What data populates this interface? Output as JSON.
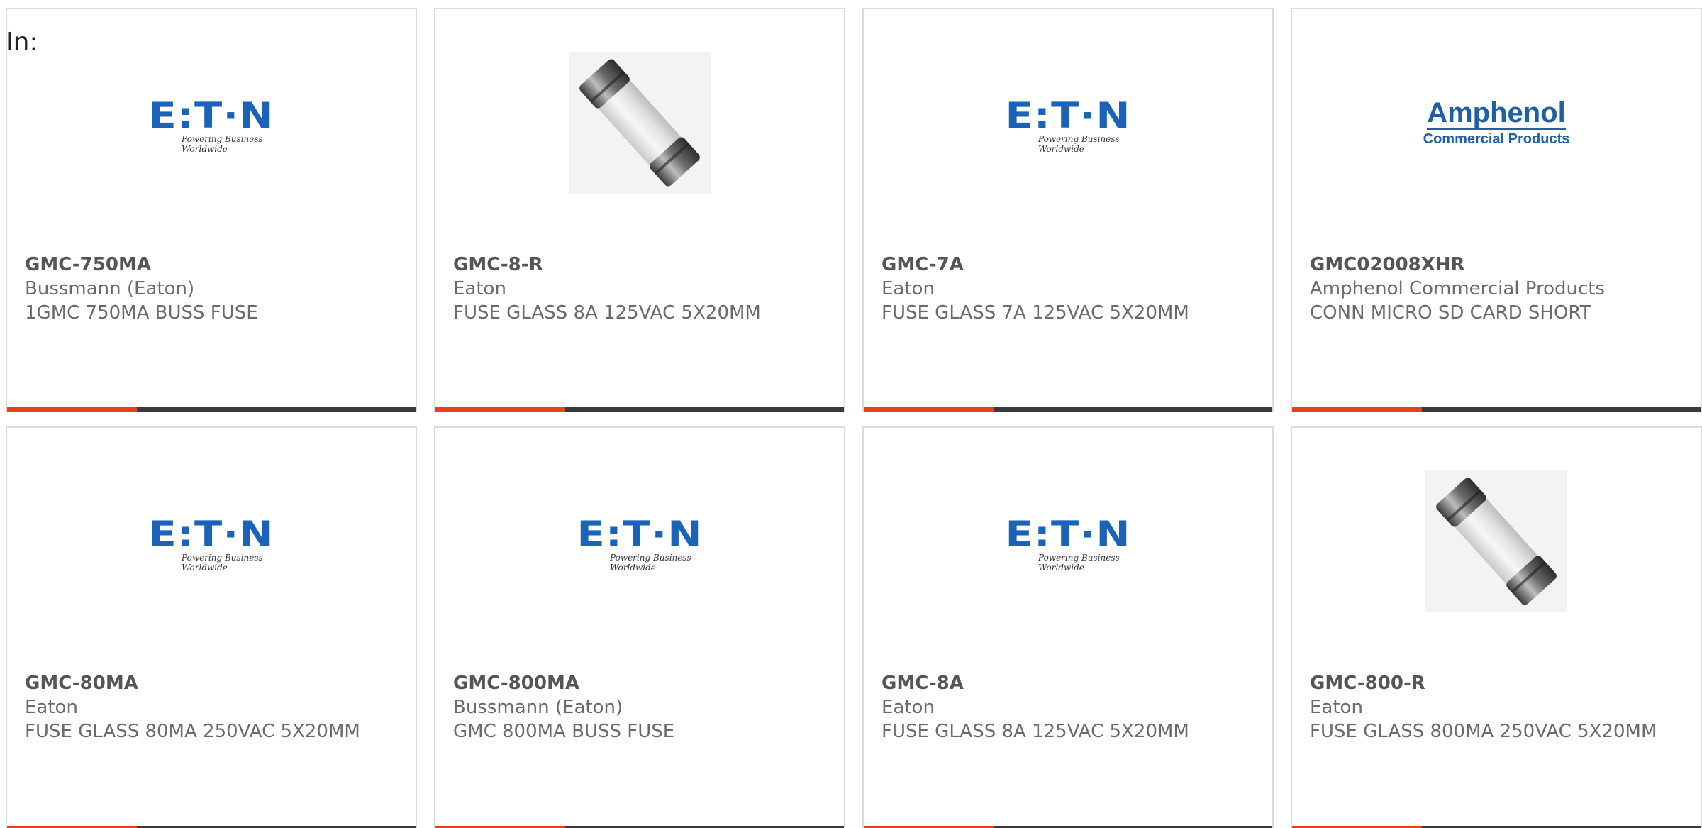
{
  "filter": {
    "label": "In:"
  },
  "products": [
    {
      "part": "GMC-750MA",
      "manufacturer": "Bussmann (Eaton)",
      "description": "1GMC 750MA BUSS FUSE",
      "image": "eaton-logo"
    },
    {
      "part": "GMC-8-R",
      "manufacturer": "Eaton",
      "description": "FUSE GLASS 8A 125VAC 5X20MM",
      "image": "glass-fuse-photo"
    },
    {
      "part": "GMC-7A",
      "manufacturer": "Eaton",
      "description": "FUSE GLASS 7A 125VAC 5X20MM",
      "image": "eaton-logo"
    },
    {
      "part": "GMC02008XHR",
      "manufacturer": "Amphenol Commercial Products",
      "description": "CONN MICRO SD CARD SHORT",
      "image": "amphenol-logo"
    },
    {
      "part": "GMC-80MA",
      "manufacturer": "Eaton",
      "description": "FUSE GLASS 80MA 250VAC 5X20MM",
      "image": "eaton-logo"
    },
    {
      "part": "GMC-800MA",
      "manufacturer": "Bussmann (Eaton)",
      "description": "GMC 800MA BUSS FUSE",
      "image": "eaton-logo"
    },
    {
      "part": "GMC-8A",
      "manufacturer": "Eaton",
      "description": "FUSE GLASS 8A 125VAC 5X20MM",
      "image": "eaton-logo"
    },
    {
      "part": "GMC-800-R",
      "manufacturer": "Eaton",
      "description": "FUSE GLASS 800MA 250VAC 5X20MM",
      "image": "glass-fuse-photo"
    }
  ],
  "logos": {
    "eaton": {
      "word": "E:T·N",
      "tagline": "Powering Business Worldwide"
    },
    "amphenol": {
      "word": "Amphenol",
      "sub": "Commercial Products"
    }
  },
  "colors": {
    "accent": "#e8401c",
    "bar": "#3a3a3a",
    "eaton_blue": "#1a63b8",
    "amphenol_blue": "#1f5fa6",
    "text": "#6b6b6b"
  }
}
